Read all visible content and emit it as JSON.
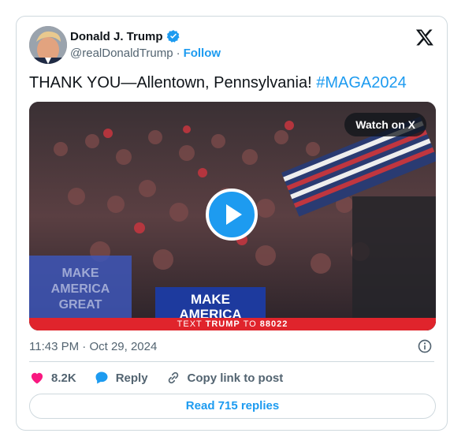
{
  "author": {
    "name": "Donald J. Trump",
    "handle": "@realDonaldTrump",
    "separator": "·",
    "follow_label": "Follow"
  },
  "tweet": {
    "text": "THANK YOU—Allentown, Pennsylvania! ",
    "hashtag": "#MAGA2024"
  },
  "media": {
    "watch_label": "Watch on X",
    "sign_text": "MAKE AMERICA",
    "sign_left_text": "MAKE AMERICA GREAT AGAIN",
    "banner_pre": "TEXT ",
    "banner_bold": "TRUMP",
    "banner_mid": " TO ",
    "banner_num": "88022"
  },
  "meta": {
    "time": "11:43 PM",
    "separator": "·",
    "date": "Oct 29, 2024"
  },
  "actions": {
    "likes": "8.2K",
    "reply_label": "Reply",
    "copy_label": "Copy link to post"
  },
  "read_replies_label": "Read 715 replies",
  "colors": {
    "accent": "#1d9bf0",
    "like": "#f91880",
    "banner": "#e0242c"
  },
  "icons": [
    "verified-badge-icon",
    "x-logo-icon",
    "play-icon",
    "info-icon",
    "heart-icon",
    "reply-bubble-icon",
    "link-icon"
  ]
}
